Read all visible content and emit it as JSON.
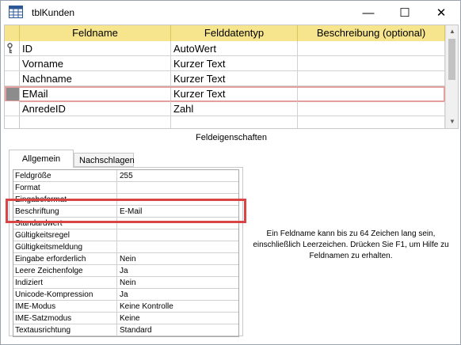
{
  "window": {
    "title": "tblKunden",
    "minimize_glyph": "—",
    "maximize_glyph": "☐",
    "close_glyph": "✕"
  },
  "grid": {
    "headers": [
      "Feldname",
      "Felddatentyp",
      "Beschreibung (optional)"
    ],
    "rows": [
      {
        "name": "ID",
        "type": "AutoWert",
        "description": "",
        "primary_key": true
      },
      {
        "name": "Vorname",
        "type": "Kurzer Text",
        "description": ""
      },
      {
        "name": "Nachname",
        "type": "Kurzer Text",
        "description": ""
      },
      {
        "name": "EMail",
        "type": "Kurzer Text",
        "description": "",
        "selected": true
      },
      {
        "name": "AnredeID",
        "type": "Zahl",
        "description": ""
      },
      {
        "name": "",
        "type": "",
        "description": ""
      }
    ],
    "header_color": "#f6e58d",
    "highlight_color": "#e4a0a0"
  },
  "section_label": "Feldeigenschaften",
  "tabs": {
    "general": "Allgemein",
    "lookup": "Nachschlagen"
  },
  "properties": [
    {
      "name": "Feldgröße",
      "value": "255"
    },
    {
      "name": "Format",
      "value": ""
    },
    {
      "name": "Eingabeformat",
      "value": ""
    },
    {
      "name": "Beschriftung",
      "value": "E-Mail"
    },
    {
      "name": "Standardwert",
      "value": ""
    },
    {
      "name": "Gültigkeitsregel",
      "value": ""
    },
    {
      "name": "Gültigkeitsmeldung",
      "value": ""
    },
    {
      "name": "Eingabe erforderlich",
      "value": "Nein"
    },
    {
      "name": "Leere Zeichenfolge",
      "value": "Ja"
    },
    {
      "name": "Indiziert",
      "value": "Nein"
    },
    {
      "name": "Unicode-Kompression",
      "value": "Ja"
    },
    {
      "name": "IME-Modus",
      "value": "Keine Kontrolle"
    },
    {
      "name": "IME-Satzmodus",
      "value": "Keine"
    },
    {
      "name": "Textausrichtung",
      "value": "Standard"
    }
  ],
  "help_text": "Ein Feldname kann bis zu 64 Zeichen lang sein, einschließlich Leerzeichen. Drücken Sie F1, um Hilfe zu Feldnamen zu erhalten.",
  "annotation_color": "#d94545",
  "icons": {
    "title": "table-icon",
    "key": "key-icon"
  }
}
